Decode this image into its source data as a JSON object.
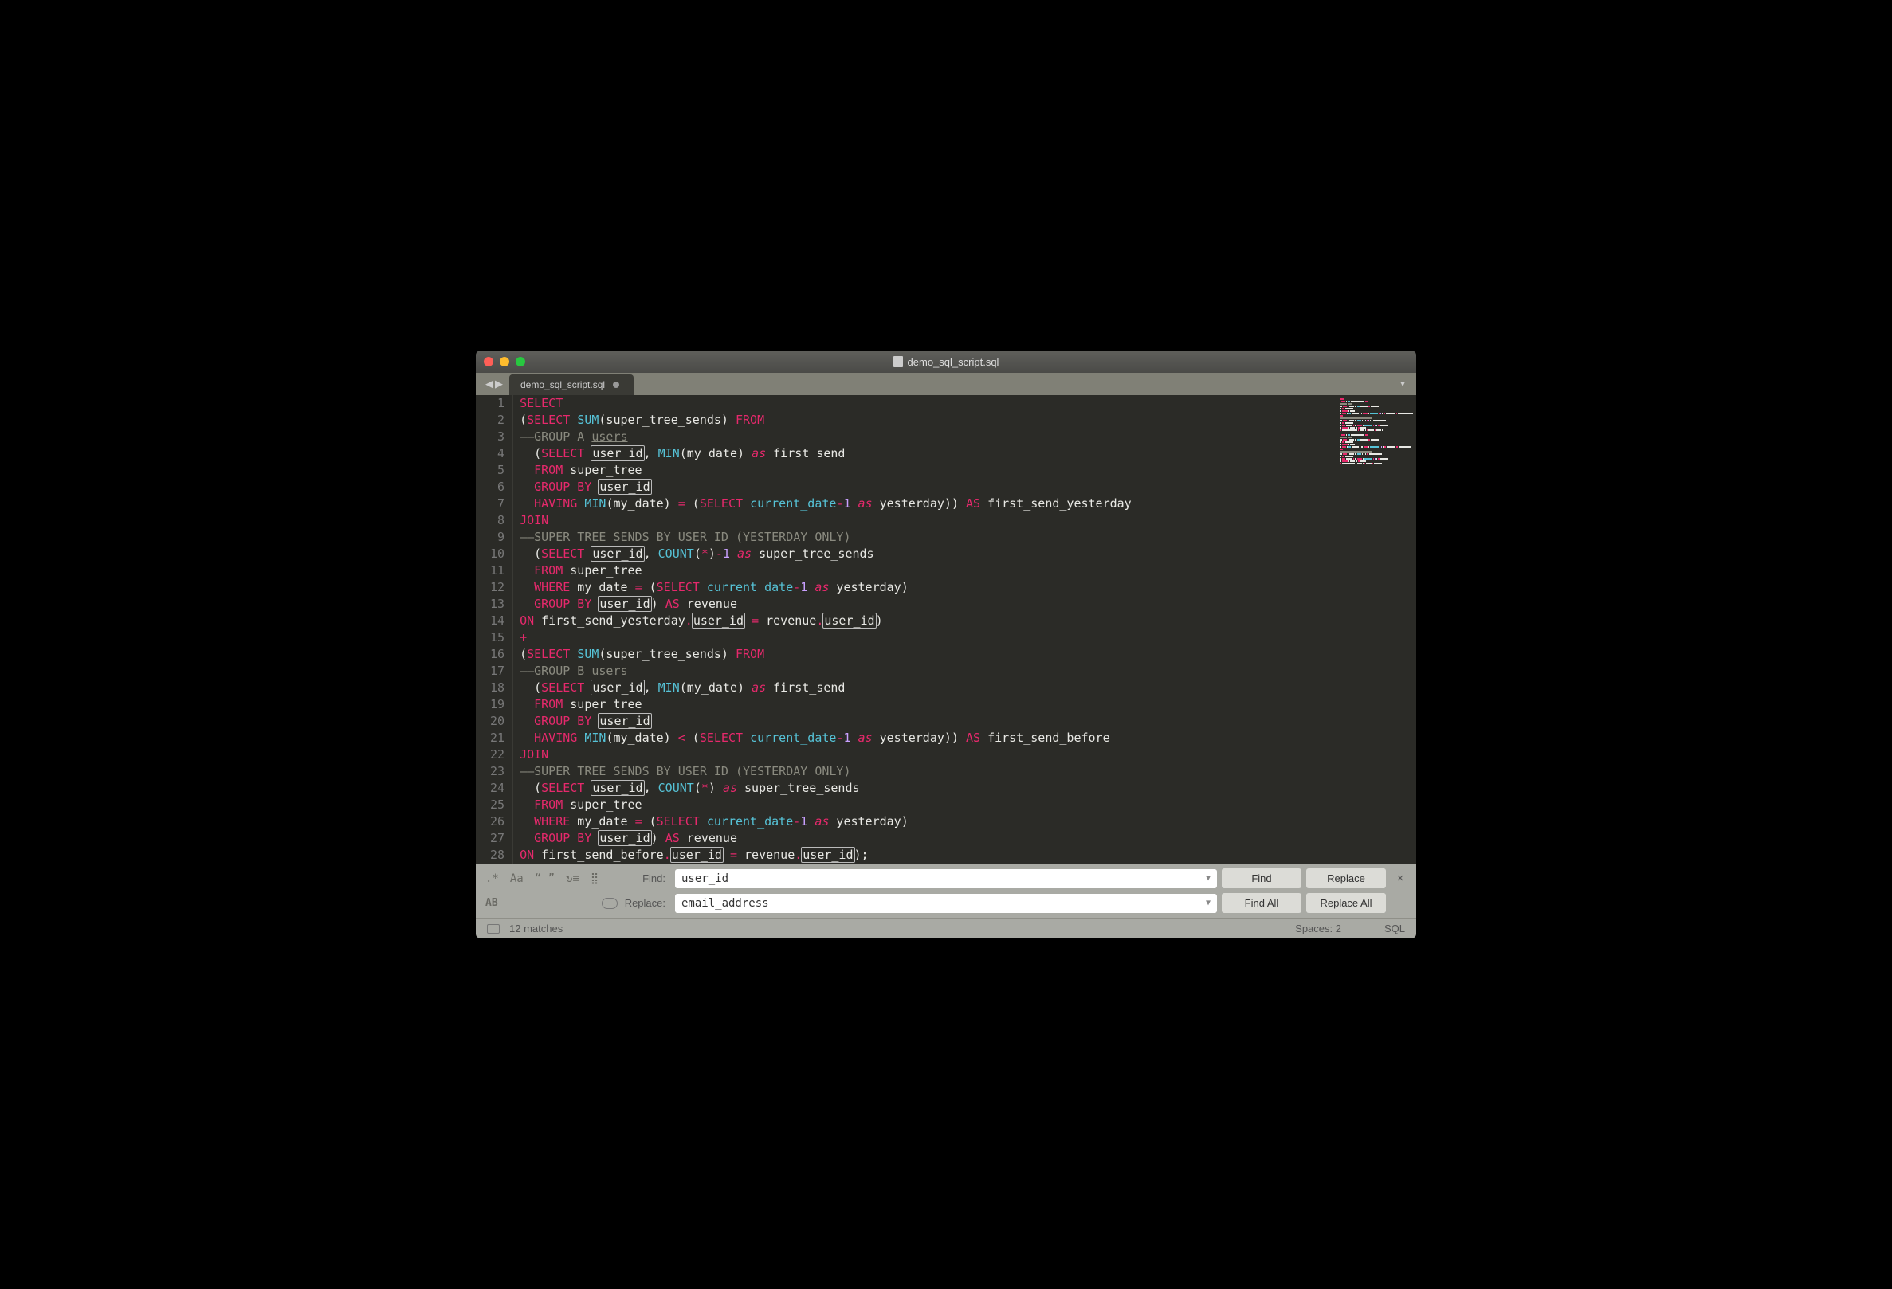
{
  "window": {
    "title": "demo_sql_script.sql"
  },
  "tabs": [
    {
      "label": "demo_sql_script.sql",
      "modified": true
    }
  ],
  "find": {
    "find_label": "Find:",
    "find_value": "user_id",
    "replace_label": "Replace:",
    "replace_value": "email_address",
    "buttons": {
      "find": "Find",
      "replace": "Replace",
      "find_all": "Find All",
      "replace_all": "Replace All"
    },
    "options": {
      "regex": ".*",
      "case": "Aa",
      "whole": "“ ”",
      "wrap": "↻≡",
      "in_selection": "⣿",
      "preserve_case": "AB",
      "highlight": "▭"
    }
  },
  "status": {
    "matches": "12 matches",
    "spaces": "Spaces: 2",
    "syntax": "SQL"
  },
  "code": {
    "lines": [
      [
        {
          "t": "SELECT",
          "c": "kw"
        }
      ],
      [
        {
          "t": "(",
          "c": "id"
        },
        {
          "t": "SELECT",
          "c": "kw"
        },
        {
          "t": " ",
          "c": "id"
        },
        {
          "t": "SUM",
          "c": "fn"
        },
        {
          "t": "(super_tree_sends) ",
          "c": "id"
        },
        {
          "t": "FROM",
          "c": "kw"
        }
      ],
      [
        {
          "t": "——GROUP A ",
          "c": "cm"
        },
        {
          "t": "users",
          "c": "cm u"
        }
      ],
      [
        {
          "t": "  (",
          "c": "id"
        },
        {
          "t": "SELECT",
          "c": "kw"
        },
        {
          "t": " ",
          "c": "id"
        },
        {
          "t": "user_id",
          "c": "id hl"
        },
        {
          "t": ", ",
          "c": "id"
        },
        {
          "t": "MIN",
          "c": "fn"
        },
        {
          "t": "(my_date) ",
          "c": "id"
        },
        {
          "t": "as",
          "c": "as"
        },
        {
          "t": " first_send",
          "c": "id"
        }
      ],
      [
        {
          "t": "  ",
          "c": "id"
        },
        {
          "t": "FROM",
          "c": "kw"
        },
        {
          "t": " super_tree",
          "c": "id"
        }
      ],
      [
        {
          "t": "  ",
          "c": "id"
        },
        {
          "t": "GROUP BY",
          "c": "kw"
        },
        {
          "t": " ",
          "c": "id"
        },
        {
          "t": "user_id",
          "c": "id hl"
        }
      ],
      [
        {
          "t": "  ",
          "c": "id"
        },
        {
          "t": "HAVING",
          "c": "kw"
        },
        {
          "t": " ",
          "c": "id"
        },
        {
          "t": "MIN",
          "c": "fn"
        },
        {
          "t": "(my_date) ",
          "c": "id"
        },
        {
          "t": "=",
          "c": "op"
        },
        {
          "t": " (",
          "c": "id"
        },
        {
          "t": "SELECT",
          "c": "kw"
        },
        {
          "t": " ",
          "c": "id"
        },
        {
          "t": "current_date",
          "c": "fn"
        },
        {
          "t": "-",
          "c": "op"
        },
        {
          "t": "1",
          "c": "num"
        },
        {
          "t": " ",
          "c": "id"
        },
        {
          "t": "as",
          "c": "as"
        },
        {
          "t": " yesterday)) ",
          "c": "id"
        },
        {
          "t": "AS",
          "c": "kw"
        },
        {
          "t": " first_send_yesterday",
          "c": "id"
        }
      ],
      [
        {
          "t": "JOIN",
          "c": "kw"
        }
      ],
      [
        {
          "t": "——SUPER TREE SENDS BY USER ID (YESTERDAY ONLY)",
          "c": "cm"
        }
      ],
      [
        {
          "t": "  (",
          "c": "id"
        },
        {
          "t": "SELECT",
          "c": "kw"
        },
        {
          "t": " ",
          "c": "id"
        },
        {
          "t": "user_id",
          "c": "id hl"
        },
        {
          "t": ", ",
          "c": "id"
        },
        {
          "t": "COUNT",
          "c": "fn"
        },
        {
          "t": "(",
          "c": "id"
        },
        {
          "t": "*",
          "c": "op"
        },
        {
          "t": ")",
          "c": "id"
        },
        {
          "t": "-",
          "c": "op"
        },
        {
          "t": "1",
          "c": "num"
        },
        {
          "t": " ",
          "c": "id"
        },
        {
          "t": "as",
          "c": "as"
        },
        {
          "t": " super_tree_sends",
          "c": "id"
        }
      ],
      [
        {
          "t": "  ",
          "c": "id"
        },
        {
          "t": "FROM",
          "c": "kw"
        },
        {
          "t": " super_tree",
          "c": "id"
        }
      ],
      [
        {
          "t": "  ",
          "c": "id"
        },
        {
          "t": "WHERE",
          "c": "kw"
        },
        {
          "t": " my_date ",
          "c": "id"
        },
        {
          "t": "=",
          "c": "op"
        },
        {
          "t": " (",
          "c": "id"
        },
        {
          "t": "SELECT",
          "c": "kw"
        },
        {
          "t": " ",
          "c": "id"
        },
        {
          "t": "current_date",
          "c": "fn"
        },
        {
          "t": "-",
          "c": "op"
        },
        {
          "t": "1",
          "c": "num"
        },
        {
          "t": " ",
          "c": "id"
        },
        {
          "t": "as",
          "c": "as"
        },
        {
          "t": " yesterday)",
          "c": "id"
        }
      ],
      [
        {
          "t": "  ",
          "c": "id"
        },
        {
          "t": "GROUP BY",
          "c": "kw"
        },
        {
          "t": " ",
          "c": "id"
        },
        {
          "t": "user_id",
          "c": "id hl"
        },
        {
          "t": ") ",
          "c": "id"
        },
        {
          "t": "AS",
          "c": "kw"
        },
        {
          "t": " revenue",
          "c": "id"
        }
      ],
      [
        {
          "t": "ON",
          "c": "kw"
        },
        {
          "t": " first_send_yesterday",
          "c": "id"
        },
        {
          "t": ".",
          "c": "op"
        },
        {
          "t": "user_id",
          "c": "id hl"
        },
        {
          "t": " ",
          "c": "id"
        },
        {
          "t": "=",
          "c": "op"
        },
        {
          "t": " revenue",
          "c": "id"
        },
        {
          "t": ".",
          "c": "op"
        },
        {
          "t": "user_id",
          "c": "id hl"
        },
        {
          "t": ")",
          "c": "id"
        }
      ],
      [
        {
          "t": "+",
          "c": "op"
        }
      ],
      [
        {
          "t": "(",
          "c": "id"
        },
        {
          "t": "SELECT",
          "c": "kw"
        },
        {
          "t": " ",
          "c": "id"
        },
        {
          "t": "SUM",
          "c": "fn"
        },
        {
          "t": "(super_tree_sends) ",
          "c": "id"
        },
        {
          "t": "FROM",
          "c": "kw"
        }
      ],
      [
        {
          "t": "——GROUP B ",
          "c": "cm"
        },
        {
          "t": "users",
          "c": "cm u"
        }
      ],
      [
        {
          "t": "  (",
          "c": "id"
        },
        {
          "t": "SELECT",
          "c": "kw"
        },
        {
          "t": " ",
          "c": "id"
        },
        {
          "t": "user_id",
          "c": "id hl"
        },
        {
          "t": ", ",
          "c": "id"
        },
        {
          "t": "MIN",
          "c": "fn"
        },
        {
          "t": "(my_date) ",
          "c": "id"
        },
        {
          "t": "as",
          "c": "as"
        },
        {
          "t": " first_send",
          "c": "id"
        }
      ],
      [
        {
          "t": "  ",
          "c": "id"
        },
        {
          "t": "FROM",
          "c": "kw"
        },
        {
          "t": " super_tree",
          "c": "id"
        }
      ],
      [
        {
          "t": "  ",
          "c": "id"
        },
        {
          "t": "GROUP BY",
          "c": "kw"
        },
        {
          "t": " ",
          "c": "id"
        },
        {
          "t": "user_id",
          "c": "id hl"
        }
      ],
      [
        {
          "t": "  ",
          "c": "id"
        },
        {
          "t": "HAVING",
          "c": "kw"
        },
        {
          "t": " ",
          "c": "id"
        },
        {
          "t": "MIN",
          "c": "fn"
        },
        {
          "t": "(my_date) ",
          "c": "id"
        },
        {
          "t": "<",
          "c": "op"
        },
        {
          "t": " (",
          "c": "id"
        },
        {
          "t": "SELECT",
          "c": "kw"
        },
        {
          "t": " ",
          "c": "id"
        },
        {
          "t": "current_date",
          "c": "fn"
        },
        {
          "t": "-",
          "c": "op"
        },
        {
          "t": "1",
          "c": "num"
        },
        {
          "t": " ",
          "c": "id"
        },
        {
          "t": "as",
          "c": "as"
        },
        {
          "t": " yesterday)) ",
          "c": "id"
        },
        {
          "t": "AS",
          "c": "kw"
        },
        {
          "t": " first_send_before",
          "c": "id"
        }
      ],
      [
        {
          "t": "JOIN",
          "c": "kw"
        }
      ],
      [
        {
          "t": "——SUPER TREE SENDS BY USER ID (YESTERDAY ONLY)",
          "c": "cm"
        }
      ],
      [
        {
          "t": "  (",
          "c": "id"
        },
        {
          "t": "SELECT",
          "c": "kw"
        },
        {
          "t": " ",
          "c": "id"
        },
        {
          "t": "user_id",
          "c": "id hl"
        },
        {
          "t": ", ",
          "c": "id"
        },
        {
          "t": "COUNT",
          "c": "fn"
        },
        {
          "t": "(",
          "c": "id"
        },
        {
          "t": "*",
          "c": "op"
        },
        {
          "t": ") ",
          "c": "id"
        },
        {
          "t": "as",
          "c": "as"
        },
        {
          "t": " super_tree_sends",
          "c": "id"
        }
      ],
      [
        {
          "t": "  ",
          "c": "id"
        },
        {
          "t": "FROM",
          "c": "kw"
        },
        {
          "t": " super_tree",
          "c": "id"
        }
      ],
      [
        {
          "t": "  ",
          "c": "id"
        },
        {
          "t": "WHERE",
          "c": "kw"
        },
        {
          "t": " my_date ",
          "c": "id"
        },
        {
          "t": "=",
          "c": "op"
        },
        {
          "t": " (",
          "c": "id"
        },
        {
          "t": "SELECT",
          "c": "kw"
        },
        {
          "t": " ",
          "c": "id"
        },
        {
          "t": "current_date",
          "c": "fn"
        },
        {
          "t": "-",
          "c": "op"
        },
        {
          "t": "1",
          "c": "num"
        },
        {
          "t": " ",
          "c": "id"
        },
        {
          "t": "as",
          "c": "as"
        },
        {
          "t": " yesterday)",
          "c": "id"
        }
      ],
      [
        {
          "t": "  ",
          "c": "id"
        },
        {
          "t": "GROUP BY",
          "c": "kw"
        },
        {
          "t": " ",
          "c": "id"
        },
        {
          "t": "user_id",
          "c": "id hl"
        },
        {
          "t": ") ",
          "c": "id"
        },
        {
          "t": "AS",
          "c": "kw"
        },
        {
          "t": " revenue",
          "c": "id"
        }
      ],
      [
        {
          "t": "ON",
          "c": "kw"
        },
        {
          "t": " first_send_before",
          "c": "id"
        },
        {
          "t": ".",
          "c": "op"
        },
        {
          "t": "user_id",
          "c": "id hl"
        },
        {
          "t": " ",
          "c": "id"
        },
        {
          "t": "=",
          "c": "op"
        },
        {
          "t": " revenue",
          "c": "id"
        },
        {
          "t": ".",
          "c": "op"
        },
        {
          "t": "user_id",
          "c": "id hl"
        },
        {
          "t": ");",
          "c": "id"
        }
      ]
    ]
  }
}
